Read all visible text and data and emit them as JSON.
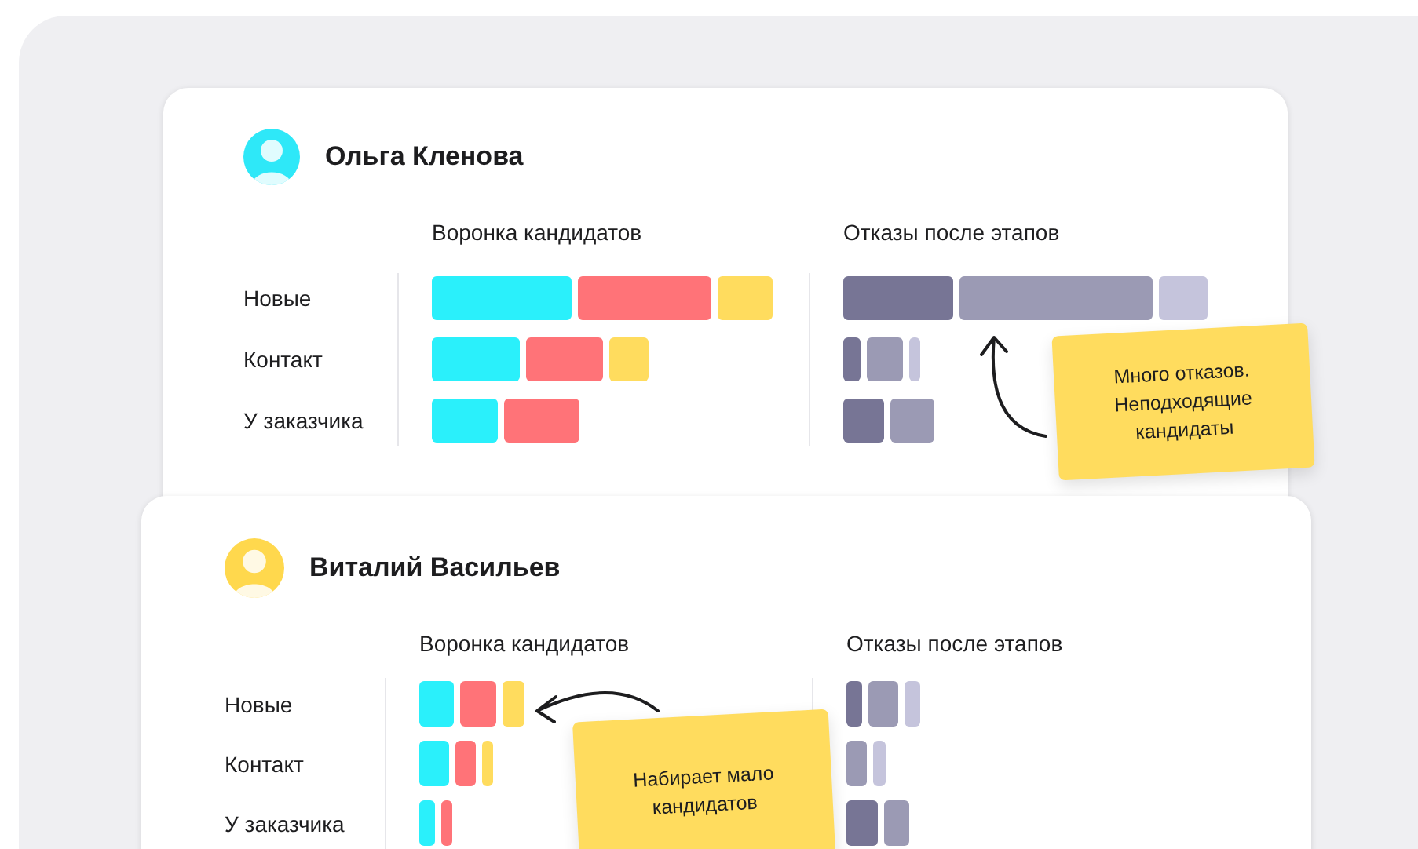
{
  "managers": [
    {
      "name": "Ольга Кленова",
      "color": "#2ee8f8",
      "stages": [
        "Новые",
        "Контакт",
        "У заказчика"
      ],
      "charts": [
        {
          "title": "Воронка кандидатов",
          "rows": [
            {
              "segments": [
                {
                  "color": "#2af0fb"
                },
                {
                  "color": "#ff7378"
                },
                {
                  "color": "#ffdc5e"
                }
              ]
            },
            {
              "segments": [
                {
                  "color": "#2af0fb"
                },
                {
                  "color": "#ff7378"
                },
                {
                  "color": "#ffdc5e"
                }
              ]
            },
            {
              "segments": [
                {
                  "color": "#2af0fb"
                },
                {
                  "color": "#ff7378"
                }
              ]
            }
          ]
        },
        {
          "title": "Отказы после этапов",
          "rows": [
            {
              "segments": [
                {
                  "color": "#777595"
                },
                {
                  "color": "#9b9ab4"
                },
                {
                  "color": "#c5c4dc"
                }
              ]
            },
            {
              "segments": [
                {
                  "color": "#777595"
                },
                {
                  "color": "#9b9ab4"
                },
                {
                  "color": "#c5c4dc"
                }
              ]
            },
            {
              "segments": [
                {
                  "color": "#777595"
                },
                {
                  "color": "#9b9ab4"
                }
              ]
            }
          ]
        }
      ],
      "note": "Много отказов. Неподходящие кандидаты"
    },
    {
      "name": "Виталий Васильев",
      "color": "#ffd84d",
      "stages": [
        "Новые",
        "Контакт",
        "У заказчика"
      ],
      "charts": [
        {
          "title": "Воронка кандидатов",
          "rows": [
            {
              "segments": [
                {
                  "color": "#2af0fb"
                },
                {
                  "color": "#ff7378"
                },
                {
                  "color": "#ffdc5e"
                }
              ]
            },
            {
              "segments": [
                {
                  "color": "#2af0fb"
                },
                {
                  "color": "#ff7378"
                },
                {
                  "color": "#ffdc5e"
                }
              ]
            },
            {
              "segments": [
                {
                  "color": "#2af0fb"
                },
                {
                  "color": "#ff7378"
                }
              ]
            }
          ]
        },
        {
          "title": "Отказы после этапов",
          "rows": [
            {
              "segments": [
                {
                  "color": "#777595"
                },
                {
                  "color": "#9b9ab4"
                },
                {
                  "color": "#c5c4dc"
                }
              ]
            },
            {
              "segments": [
                {
                  "color": "#9b9ab4"
                },
                {
                  "color": "#c5c4dc"
                }
              ]
            },
            {
              "segments": [
                {
                  "color": "#777595"
                },
                {
                  "color": "#9b9ab4"
                }
              ]
            }
          ]
        }
      ],
      "note": "Набирает мало кандидатов"
    }
  ]
}
